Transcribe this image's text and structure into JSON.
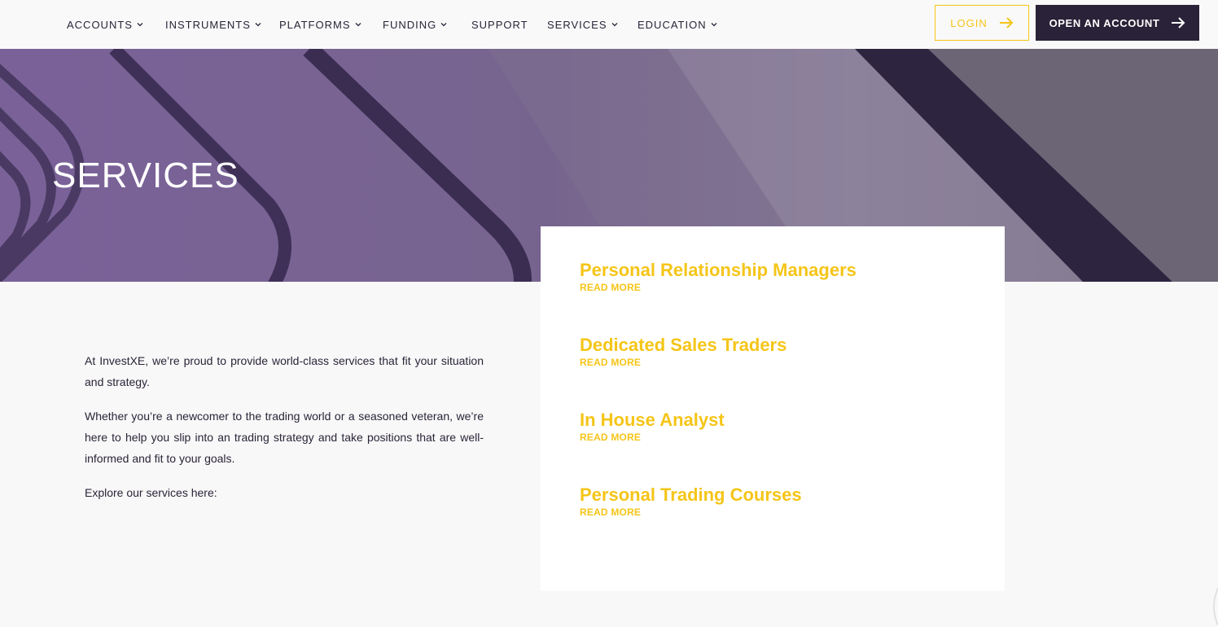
{
  "nav": {
    "items": [
      {
        "label": "ACCOUNTS",
        "dropdown": true
      },
      {
        "label": "INSTRUMENTS",
        "dropdown": true
      },
      {
        "label": "PLATFORMS",
        "dropdown": true
      },
      {
        "label": "FUNDING",
        "dropdown": true
      },
      {
        "label": "SUPPORT",
        "dropdown": false
      },
      {
        "label": "SERVICES",
        "dropdown": true
      },
      {
        "label": "EDUCATION",
        "dropdown": true
      }
    ],
    "login_label": "LOGIN",
    "open_account_label": "OPEN AN ACCOUNT"
  },
  "hero": {
    "title": "SERVICES"
  },
  "intro": {
    "paragraphs": [
      "At InvestXE, we’re proud to provide world-class services that fit your situation and strategy.",
      "Whether you’re a newcomer to the trading world or a seasoned veteran, we’re here to help you slip into an trading strategy and take positions that are well-informed and fit to your goals.",
      "Explore our services here:"
    ]
  },
  "services": [
    {
      "title": "Personal Relationship Managers",
      "link": "READ MORE"
    },
    {
      "title": "Dedicated Sales Traders",
      "link": "READ MORE"
    },
    {
      "title": "In House Analyst",
      "link": "READ MORE"
    },
    {
      "title": "Personal Trading Courses",
      "link": "READ MORE"
    }
  ],
  "colors": {
    "accent": "#f5c518",
    "dark": "#2a2238",
    "hero_purple": "#7b6594",
    "background": "#f8f8f8"
  },
  "icons": {
    "dropdown": "chevron-down-icon",
    "arrow": "arrow-right-icon"
  }
}
